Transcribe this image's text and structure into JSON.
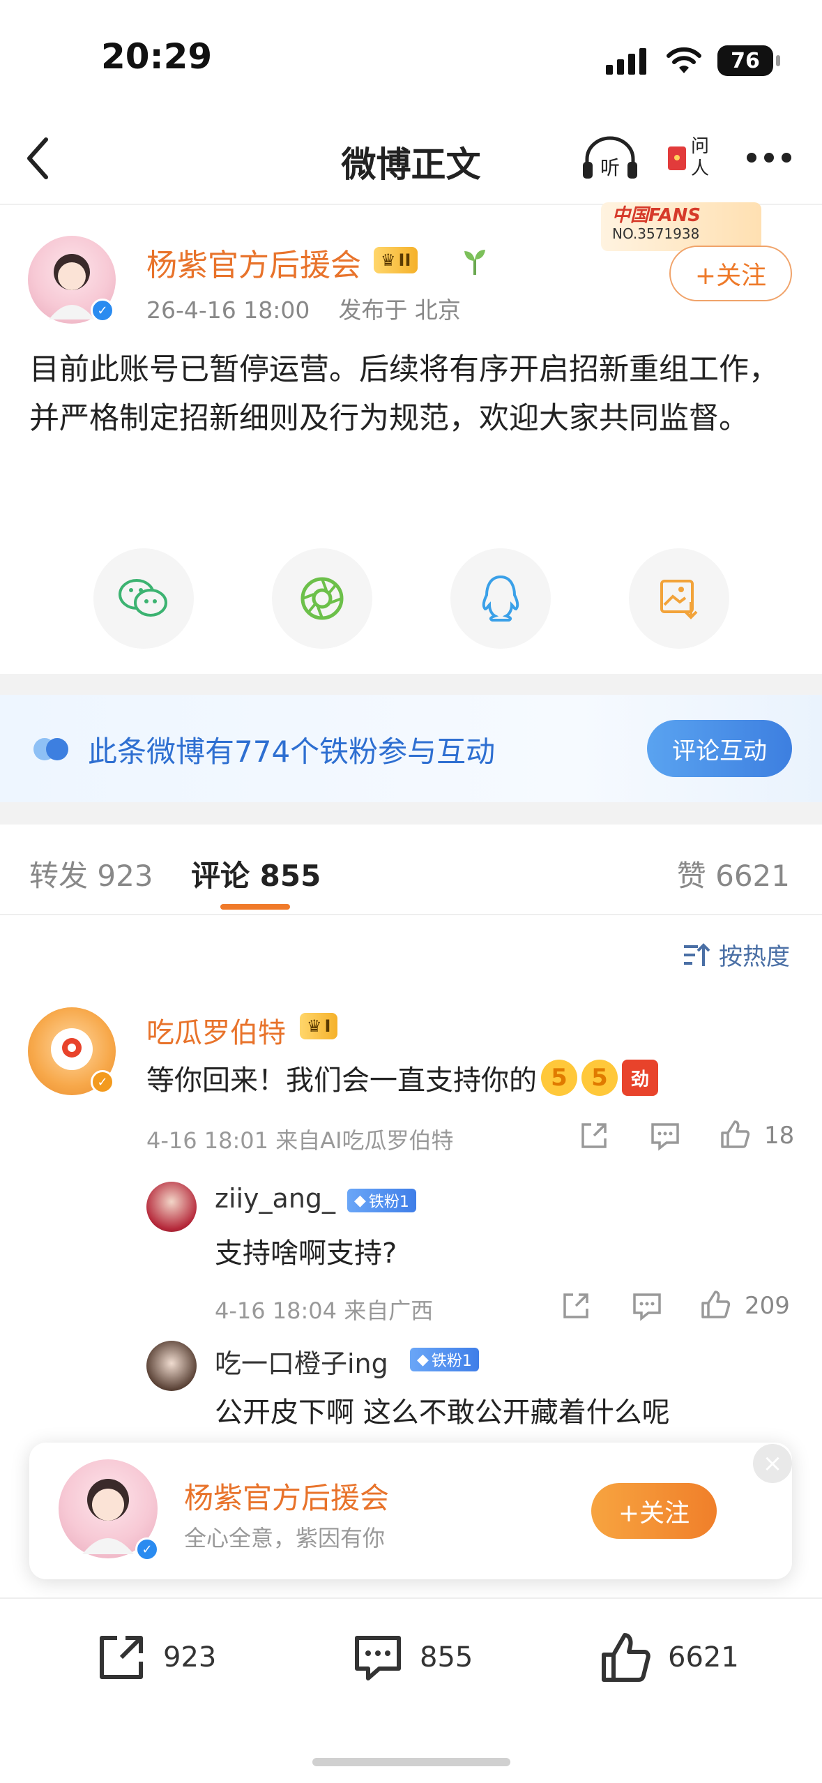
{
  "status_bar": {
    "time": "20:29",
    "battery": "76"
  },
  "nav": {
    "title": "微博正文"
  },
  "post": {
    "author": "杨紫官方后援会",
    "level_badge": "II",
    "time": "26-4-16 18:00",
    "location": "发布于 北京",
    "follow_label": "+关注",
    "fans_badge_title": "中国FANS",
    "fans_badge_no": "NO.3571938",
    "body": "目前此账号已暂停运营。后续将有序开启招新重组工作，并严格制定招新细则及行为规范，欢迎大家共同监督。",
    "share_targets": [
      "wechat-icon",
      "moments-icon",
      "qq-icon",
      "save-image-icon"
    ]
  },
  "fans_banner": {
    "text": "此条微博有774个铁粉参与互动",
    "button": "评论互动"
  },
  "tabs": {
    "repost": "转发 923",
    "comment": "评论 855",
    "like": "赞 6621",
    "sort": "按热度"
  },
  "comments": [
    {
      "user": "吃瓜罗伯特",
      "badge": "I",
      "text": "等你回来！我们会一直支持你的",
      "meta": "4-16 18:01  来自AI吃瓜罗伯特",
      "likes": "18",
      "replies": [
        {
          "user": "ziiy_ang_",
          "tag": "铁粉1",
          "text": "支持啥啊支持?",
          "meta": "4-16 18:04  来自广西",
          "likes": "209"
        },
        {
          "user": "吃一口橙子ing",
          "tag": "铁粉1",
          "text": "公开皮下啊  这么不敢公开藏着什么呢"
        }
      ]
    }
  ],
  "follow_card": {
    "name": "杨紫官方后援会",
    "subtitle": "全心全意，紫因有你",
    "follow_label": "+关注"
  },
  "bottom_bar": {
    "repost": "923",
    "comment": "855",
    "like": "6621"
  },
  "colors": {
    "accent_orange": "#e8732b",
    "link_blue": "#2e6fd1"
  }
}
